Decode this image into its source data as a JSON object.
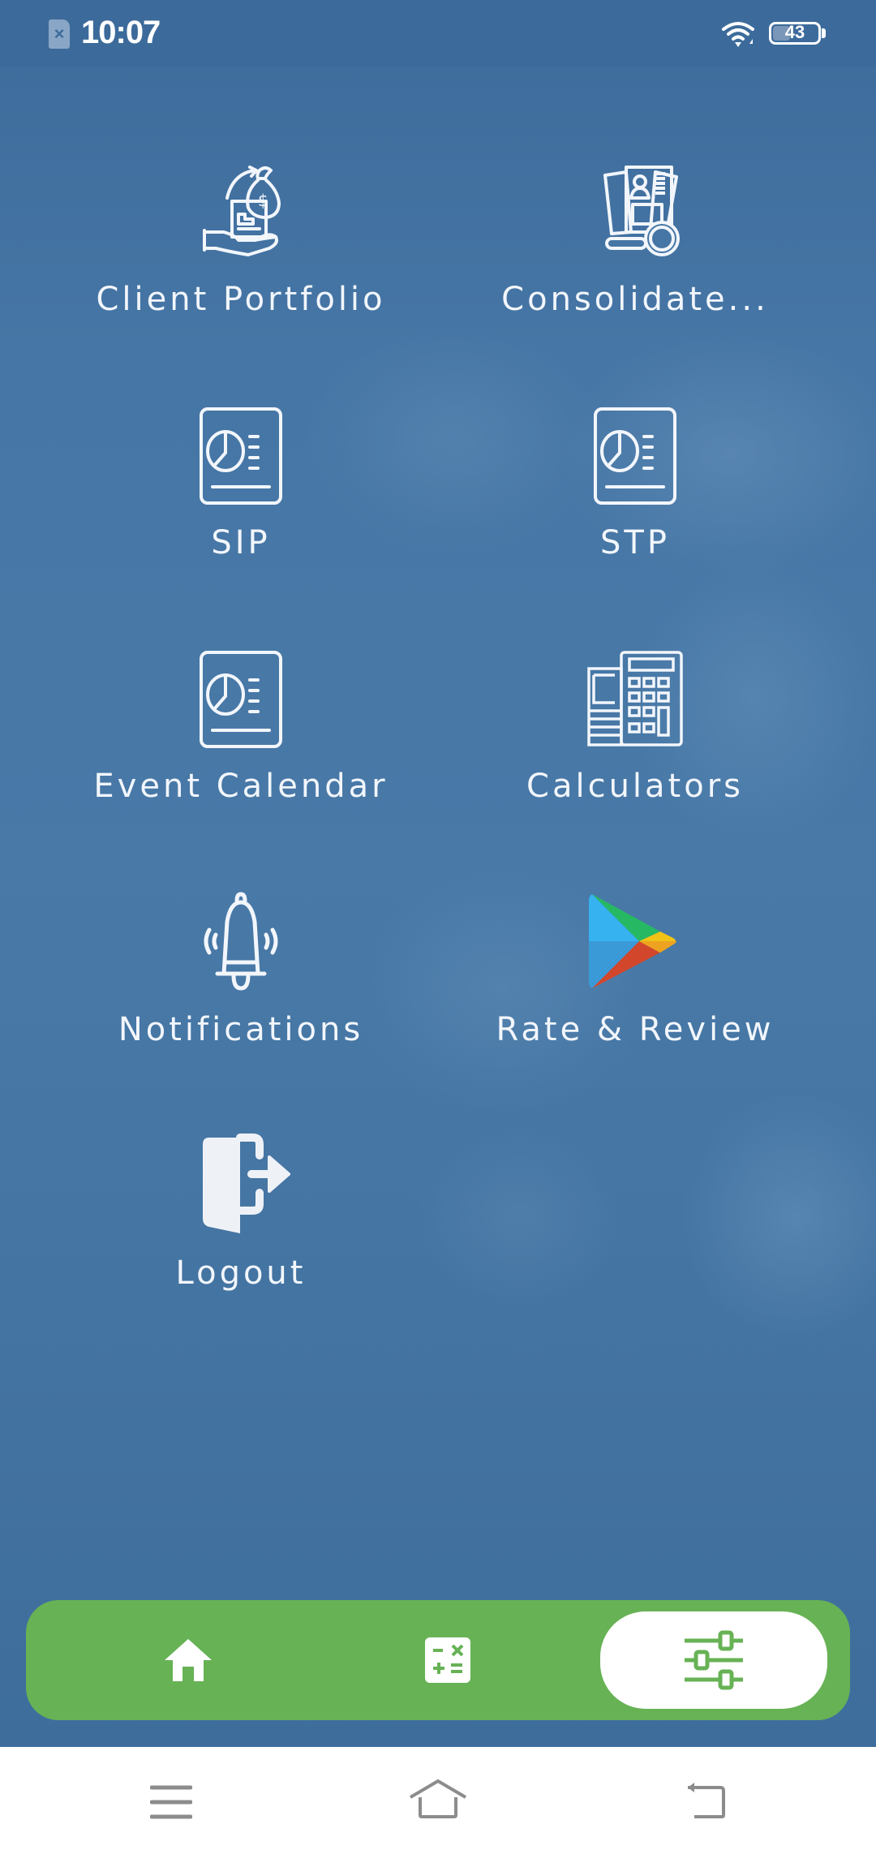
{
  "status_bar": {
    "time": "10:07",
    "sim_icon": "sim-card-absent-icon",
    "wifi_icon": "wifi-icon",
    "battery_level": "43",
    "battery_fraction": 0.43
  },
  "menu": {
    "items": [
      {
        "label": "Client Portfolio",
        "icon": "money-bag-hand-icon"
      },
      {
        "label": "Consolidate...",
        "icon": "documents-magnifier-icon"
      },
      {
        "label": "SIP",
        "icon": "pie-chart-document-icon"
      },
      {
        "label": "STP",
        "icon": "pie-chart-document-icon"
      },
      {
        "label": "Event Calendar",
        "icon": "pie-chart-document-icon"
      },
      {
        "label": "Calculators",
        "icon": "calculator-money-icon"
      },
      {
        "label": "Notifications",
        "icon": "ringing-bell-icon"
      },
      {
        "label": "Rate & Review",
        "icon": "google-play-icon"
      },
      {
        "label": "Logout",
        "icon": "logout-door-icon"
      }
    ]
  },
  "bottom_nav": {
    "items": [
      {
        "name": "home",
        "icon": "home-icon",
        "active": false
      },
      {
        "name": "calculator",
        "icon": "calculator-icon",
        "active": false
      },
      {
        "name": "settings",
        "icon": "sliders-icon",
        "active": true
      }
    ],
    "colors": {
      "bar": "#67b255",
      "active_bg": "#ffffff",
      "icon_inactive": "#ffffff",
      "icon_active": "#67b255"
    }
  },
  "system_nav": {
    "items": [
      {
        "name": "menu",
        "icon": "menu-lines-icon"
      },
      {
        "name": "home",
        "icon": "home-outline-icon"
      },
      {
        "name": "back",
        "icon": "back-arrow-icon"
      }
    ]
  },
  "colors": {
    "background": "#4676a5",
    "text": "#f2f6fb"
  }
}
